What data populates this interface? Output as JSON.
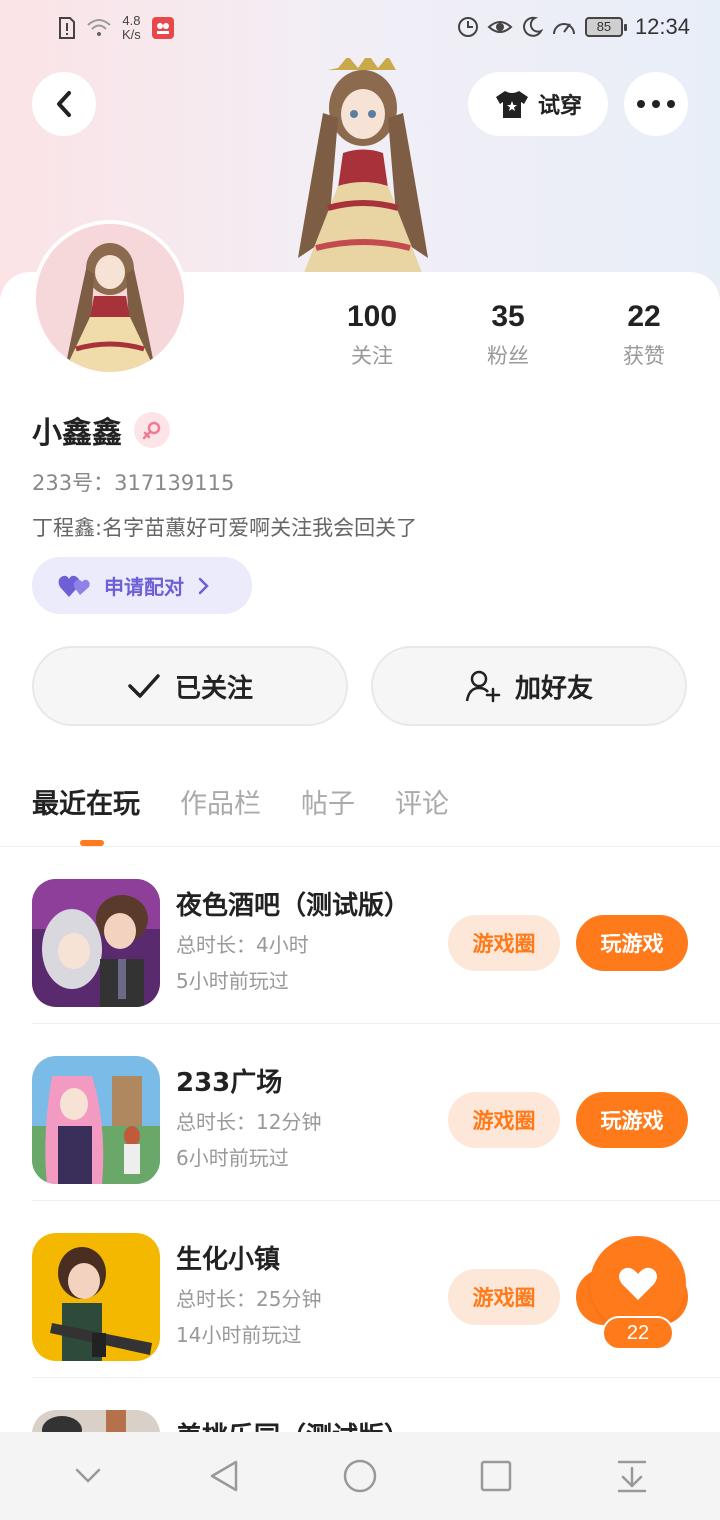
{
  "status_bar": {
    "net_speed_value": "4.8",
    "net_speed_unit": "K/s",
    "battery": "85",
    "time": "12:34"
  },
  "header": {
    "try_on_label": "试穿"
  },
  "profile": {
    "stats": [
      {
        "value": "100",
        "label": "关注"
      },
      {
        "value": "35",
        "label": "粉丝"
      },
      {
        "value": "22",
        "label": "获赞"
      }
    ],
    "nickname": "小鑫鑫",
    "uid_label": "233号：",
    "uid_value": "317139115",
    "bio": "丁程鑫:名字苗蕙好可爱啊关注我会回关了",
    "pair_label": "申请配对",
    "follow_label": "已关注",
    "add_friend_label": "加好友"
  },
  "tabs": [
    {
      "label": "最近在玩",
      "active": true
    },
    {
      "label": "作品栏",
      "active": false
    },
    {
      "label": "帖子",
      "active": false
    },
    {
      "label": "评论",
      "active": false
    }
  ],
  "games": [
    {
      "title": "夜色酒吧（测试版）",
      "duration": "总时长：4小时",
      "last_played": "5小时前玩过",
      "circle_label": "游戏圈",
      "play_label": "玩游戏"
    },
    {
      "title": "233广场",
      "duration": "总时长：12分钟",
      "last_played": "6小时前玩过",
      "circle_label": "游戏圈",
      "play_label": "玩游戏"
    },
    {
      "title": "生化小镇",
      "duration": "总时长：25分钟",
      "last_played": "14小时前玩过",
      "circle_label": "游戏圈",
      "play_label": "玩游戏"
    },
    {
      "title": "美桃乐园（测试版）"
    }
  ],
  "like_button": {
    "count": "22"
  },
  "colors": {
    "accent": "#ff7a1a",
    "accent_light": "#fde7d9",
    "pair_purple": "#6d5fd6",
    "pair_bg": "#ecebfb"
  }
}
